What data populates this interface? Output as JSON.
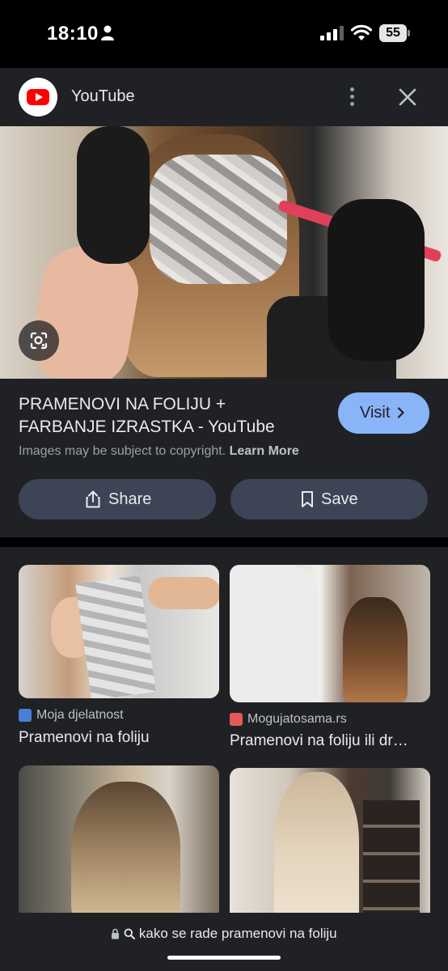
{
  "status_bar": {
    "time": "18:10",
    "battery": "55"
  },
  "source": {
    "name": "YouTube",
    "logo_icon": "youtube-logo"
  },
  "result": {
    "title": "PRAMENOVI NA FOLIJU + FARBANJE IZRASTKA - YouTube",
    "visit_label": "Visit",
    "copyright_text": "Images may be subject to copyright.",
    "learn_more": "Learn More",
    "share_label": "Share",
    "save_label": "Save"
  },
  "related": [
    {
      "source": "Moja djelatnost",
      "title": "Pramenovi na foliju",
      "favicon_color": "#4a7fd4"
    },
    {
      "source": "Mogujatosama.rs",
      "title": "Pramenovi na foliju ili dr…",
      "favicon_color": "#e05a5a"
    },
    {
      "source": "",
      "title": ""
    },
    {
      "source": "",
      "title": ""
    }
  ],
  "bottom": {
    "query": "kako se rade pramenovi na foliju"
  },
  "colors": {
    "background": "#202124",
    "accent": "#8ab4f8",
    "button_bg": "#3c4455"
  }
}
